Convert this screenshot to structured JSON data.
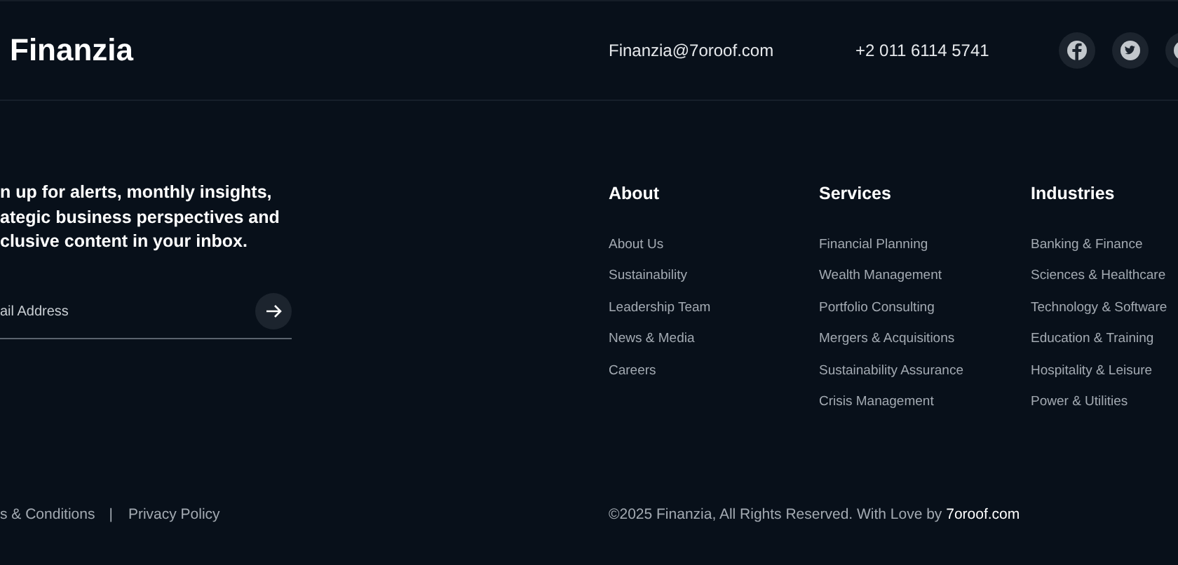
{
  "header": {
    "logo": "Finanzia",
    "email": "Finanzia@7oroof.com",
    "phone": "+2 011 6114 5741",
    "social": [
      {
        "kind": "facebook"
      },
      {
        "kind": "twitter"
      },
      {
        "kind": "partial"
      }
    ]
  },
  "newsletter": {
    "lines": [
      "n up for alerts, monthly insights,",
      "ategic business perspectives and",
      "clusive content in your inbox."
    ],
    "placeholder": "ail Address"
  },
  "columns": [
    {
      "title": "About",
      "links": [
        "About Us",
        "Sustainability",
        "Leadership Team",
        "News & Media",
        "Careers"
      ]
    },
    {
      "title": "Services",
      "links": [
        "Financial Planning",
        "Wealth Management",
        "Portfolio Consulting",
        "Mergers & Acquisitions",
        "Sustainability Assurance",
        "Crisis Management"
      ]
    },
    {
      "title": "Industries",
      "links": [
        "Banking & Finance",
        "Sciences & Healthcare",
        "Technology & Software",
        "Education & Training",
        "Hospitality & Leisure",
        "Power & Utilities"
      ]
    }
  ],
  "bottom": {
    "legal_links": [
      "s & Conditions",
      "Privacy Policy"
    ],
    "separator": "|",
    "copyright": "©2025 Finanzia, All Rights Reserved. With Love by",
    "site_link": "7oroof.com"
  }
}
